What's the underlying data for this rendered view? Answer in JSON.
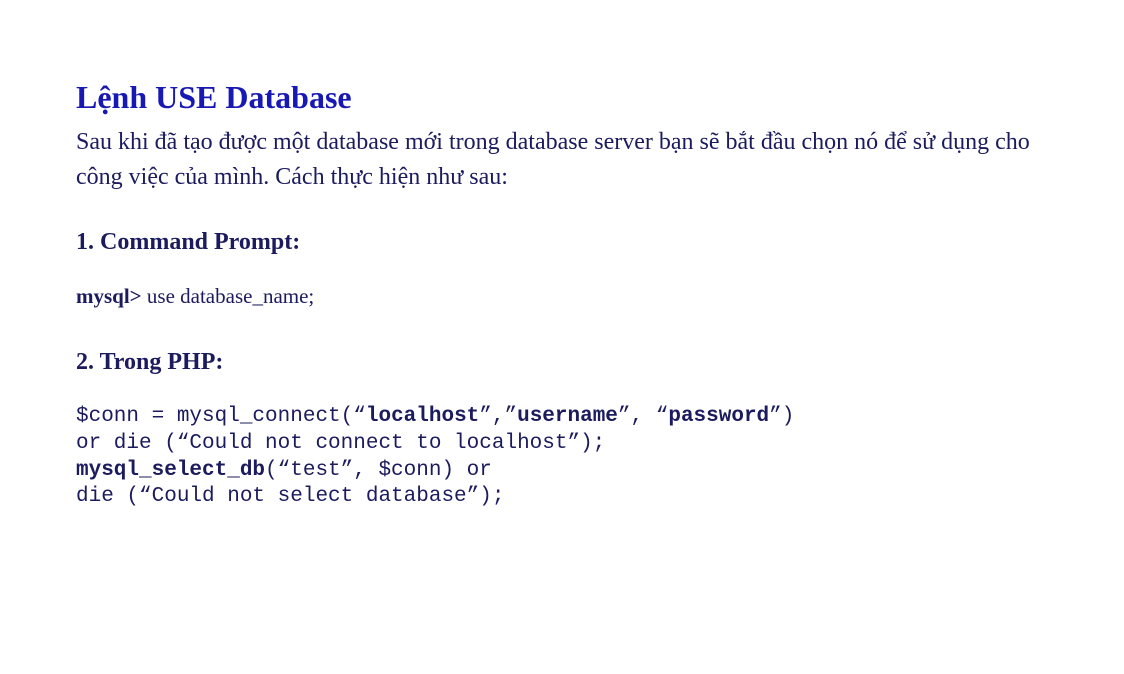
{
  "title": "Lệnh USE Database",
  "intro": "Sau khi đã tạo được một database mới trong database server bạn sẽ bắt đầu chọn nó để sử dụng cho công việc của mình. Cách thực hiện như sau:",
  "section1": {
    "heading": "1. Command Prompt:",
    "prompt_bold": "mysql>",
    "prompt_rest": " use database_name;"
  },
  "section2": {
    "heading": "2. Trong PHP:",
    "code": {
      "l1_a": "$conn = mysql_connect(“",
      "l1_b_bold": "localhost",
      "l1_c": "”,”",
      "l1_d_bold": "username",
      "l1_e": "”, “",
      "l1_f_bold": "password",
      "l1_g": "”)",
      "l2": "or die (“Could not connect to localhost”);",
      "l3_a_bold": "mysql_select_db",
      "l3_b": "(“test”, $conn) or",
      "l4": "die (“Could not select database”);"
    }
  }
}
